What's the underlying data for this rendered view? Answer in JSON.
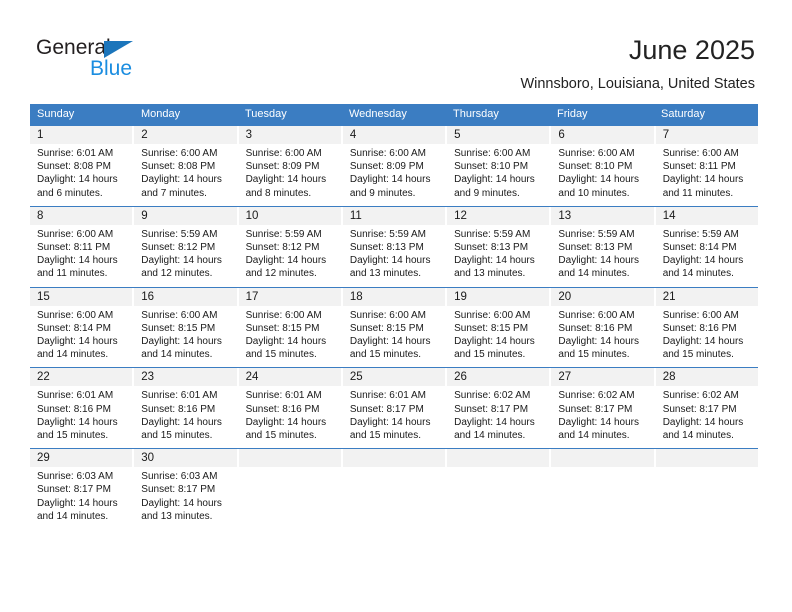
{
  "brand": {
    "name_dark": "General",
    "name_blue": "Blue",
    "accent_blue": "#3b7dc2",
    "logo_blue": "#1b8de0"
  },
  "header": {
    "title": "June 2025",
    "location": "Winnsboro, Louisiana, United States"
  },
  "calendar": {
    "day_headers": [
      "Sunday",
      "Monday",
      "Tuesday",
      "Wednesday",
      "Thursday",
      "Friday",
      "Saturday"
    ],
    "weeks": [
      [
        {
          "day": "1",
          "sunrise": "Sunrise: 6:01 AM",
          "sunset": "Sunset: 8:08 PM",
          "daylight1": "Daylight: 14 hours",
          "daylight2": "and 6 minutes."
        },
        {
          "day": "2",
          "sunrise": "Sunrise: 6:00 AM",
          "sunset": "Sunset: 8:08 PM",
          "daylight1": "Daylight: 14 hours",
          "daylight2": "and 7 minutes."
        },
        {
          "day": "3",
          "sunrise": "Sunrise: 6:00 AM",
          "sunset": "Sunset: 8:09 PM",
          "daylight1": "Daylight: 14 hours",
          "daylight2": "and 8 minutes."
        },
        {
          "day": "4",
          "sunrise": "Sunrise: 6:00 AM",
          "sunset": "Sunset: 8:09 PM",
          "daylight1": "Daylight: 14 hours",
          "daylight2": "and 9 minutes."
        },
        {
          "day": "5",
          "sunrise": "Sunrise: 6:00 AM",
          "sunset": "Sunset: 8:10 PM",
          "daylight1": "Daylight: 14 hours",
          "daylight2": "and 9 minutes."
        },
        {
          "day": "6",
          "sunrise": "Sunrise: 6:00 AM",
          "sunset": "Sunset: 8:10 PM",
          "daylight1": "Daylight: 14 hours",
          "daylight2": "and 10 minutes."
        },
        {
          "day": "7",
          "sunrise": "Sunrise: 6:00 AM",
          "sunset": "Sunset: 8:11 PM",
          "daylight1": "Daylight: 14 hours",
          "daylight2": "and 11 minutes."
        }
      ],
      [
        {
          "day": "8",
          "sunrise": "Sunrise: 6:00 AM",
          "sunset": "Sunset: 8:11 PM",
          "daylight1": "Daylight: 14 hours",
          "daylight2": "and 11 minutes."
        },
        {
          "day": "9",
          "sunrise": "Sunrise: 5:59 AM",
          "sunset": "Sunset: 8:12 PM",
          "daylight1": "Daylight: 14 hours",
          "daylight2": "and 12 minutes."
        },
        {
          "day": "10",
          "sunrise": "Sunrise: 5:59 AM",
          "sunset": "Sunset: 8:12 PM",
          "daylight1": "Daylight: 14 hours",
          "daylight2": "and 12 minutes."
        },
        {
          "day": "11",
          "sunrise": "Sunrise: 5:59 AM",
          "sunset": "Sunset: 8:13 PM",
          "daylight1": "Daylight: 14 hours",
          "daylight2": "and 13 minutes."
        },
        {
          "day": "12",
          "sunrise": "Sunrise: 5:59 AM",
          "sunset": "Sunset: 8:13 PM",
          "daylight1": "Daylight: 14 hours",
          "daylight2": "and 13 minutes."
        },
        {
          "day": "13",
          "sunrise": "Sunrise: 5:59 AM",
          "sunset": "Sunset: 8:13 PM",
          "daylight1": "Daylight: 14 hours",
          "daylight2": "and 14 minutes."
        },
        {
          "day": "14",
          "sunrise": "Sunrise: 5:59 AM",
          "sunset": "Sunset: 8:14 PM",
          "daylight1": "Daylight: 14 hours",
          "daylight2": "and 14 minutes."
        }
      ],
      [
        {
          "day": "15",
          "sunrise": "Sunrise: 6:00 AM",
          "sunset": "Sunset: 8:14 PM",
          "daylight1": "Daylight: 14 hours",
          "daylight2": "and 14 minutes."
        },
        {
          "day": "16",
          "sunrise": "Sunrise: 6:00 AM",
          "sunset": "Sunset: 8:15 PM",
          "daylight1": "Daylight: 14 hours",
          "daylight2": "and 14 minutes."
        },
        {
          "day": "17",
          "sunrise": "Sunrise: 6:00 AM",
          "sunset": "Sunset: 8:15 PM",
          "daylight1": "Daylight: 14 hours",
          "daylight2": "and 15 minutes."
        },
        {
          "day": "18",
          "sunrise": "Sunrise: 6:00 AM",
          "sunset": "Sunset: 8:15 PM",
          "daylight1": "Daylight: 14 hours",
          "daylight2": "and 15 minutes."
        },
        {
          "day": "19",
          "sunrise": "Sunrise: 6:00 AM",
          "sunset": "Sunset: 8:15 PM",
          "daylight1": "Daylight: 14 hours",
          "daylight2": "and 15 minutes."
        },
        {
          "day": "20",
          "sunrise": "Sunrise: 6:00 AM",
          "sunset": "Sunset: 8:16 PM",
          "daylight1": "Daylight: 14 hours",
          "daylight2": "and 15 minutes."
        },
        {
          "day": "21",
          "sunrise": "Sunrise: 6:00 AM",
          "sunset": "Sunset: 8:16 PM",
          "daylight1": "Daylight: 14 hours",
          "daylight2": "and 15 minutes."
        }
      ],
      [
        {
          "day": "22",
          "sunrise": "Sunrise: 6:01 AM",
          "sunset": "Sunset: 8:16 PM",
          "daylight1": "Daylight: 14 hours",
          "daylight2": "and 15 minutes."
        },
        {
          "day": "23",
          "sunrise": "Sunrise: 6:01 AM",
          "sunset": "Sunset: 8:16 PM",
          "daylight1": "Daylight: 14 hours",
          "daylight2": "and 15 minutes."
        },
        {
          "day": "24",
          "sunrise": "Sunrise: 6:01 AM",
          "sunset": "Sunset: 8:16 PM",
          "daylight1": "Daylight: 14 hours",
          "daylight2": "and 15 minutes."
        },
        {
          "day": "25",
          "sunrise": "Sunrise: 6:01 AM",
          "sunset": "Sunset: 8:17 PM",
          "daylight1": "Daylight: 14 hours",
          "daylight2": "and 15 minutes."
        },
        {
          "day": "26",
          "sunrise": "Sunrise: 6:02 AM",
          "sunset": "Sunset: 8:17 PM",
          "daylight1": "Daylight: 14 hours",
          "daylight2": "and 14 minutes."
        },
        {
          "day": "27",
          "sunrise": "Sunrise: 6:02 AM",
          "sunset": "Sunset: 8:17 PM",
          "daylight1": "Daylight: 14 hours",
          "daylight2": "and 14 minutes."
        },
        {
          "day": "28",
          "sunrise": "Sunrise: 6:02 AM",
          "sunset": "Sunset: 8:17 PM",
          "daylight1": "Daylight: 14 hours",
          "daylight2": "and 14 minutes."
        }
      ],
      [
        {
          "day": "29",
          "sunrise": "Sunrise: 6:03 AM",
          "sunset": "Sunset: 8:17 PM",
          "daylight1": "Daylight: 14 hours",
          "daylight2": "and 14 minutes."
        },
        {
          "day": "30",
          "sunrise": "Sunrise: 6:03 AM",
          "sunset": "Sunset: 8:17 PM",
          "daylight1": "Daylight: 14 hours",
          "daylight2": "and 13 minutes."
        },
        {
          "day": "",
          "sunrise": "",
          "sunset": "",
          "daylight1": "",
          "daylight2": ""
        },
        {
          "day": "",
          "sunrise": "",
          "sunset": "",
          "daylight1": "",
          "daylight2": ""
        },
        {
          "day": "",
          "sunrise": "",
          "sunset": "",
          "daylight1": "",
          "daylight2": ""
        },
        {
          "day": "",
          "sunrise": "",
          "sunset": "",
          "daylight1": "",
          "daylight2": ""
        },
        {
          "day": "",
          "sunrise": "",
          "sunset": "",
          "daylight1": "",
          "daylight2": ""
        }
      ]
    ]
  }
}
